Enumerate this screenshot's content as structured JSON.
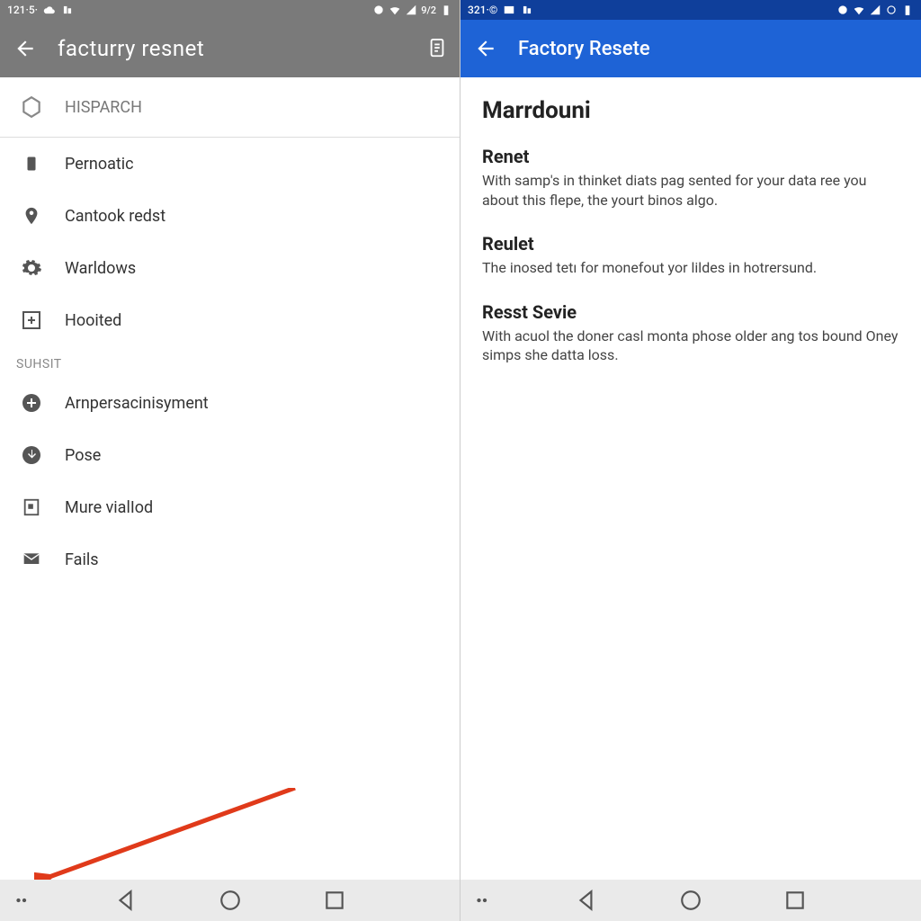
{
  "left": {
    "status": {
      "time": "121·5·",
      "indicators": "9/2"
    },
    "appbar": {
      "title": "facturry resnet"
    },
    "section1": {
      "header": "HISPARCH"
    },
    "items1": [
      {
        "icon": "phone-icon",
        "label": "Pernoatic"
      },
      {
        "icon": "pin-icon",
        "label": "Cantook redst"
      },
      {
        "icon": "gear-icon",
        "label": "Warldows"
      },
      {
        "icon": "plus-box-icon",
        "label": "Hooited"
      }
    ],
    "group2_label": "SUHSIT",
    "items2": [
      {
        "icon": "plus-circle-icon",
        "label": "Arnpersacinisyment"
      },
      {
        "icon": "download-icon",
        "label": "Pose"
      },
      {
        "icon": "note-icon",
        "label": "Mure vialIod"
      },
      {
        "icon": "mail-icon",
        "label": "Fails"
      }
    ]
  },
  "right": {
    "status": {
      "time": "321·©"
    },
    "appbar": {
      "title": "Factory Resete"
    },
    "heading": "Marrdouni",
    "blocks": [
      {
        "title": "Renet",
        "body": "With samp's in thinket diats pag sented for your data ree you about this flepe, the yourt binos algo."
      },
      {
        "title": "Reulet",
        "body": "The inosed tetı for monefout yor lildes in hotrersund."
      },
      {
        "title": "Resst Sevie",
        "body": "With acuol the doner casl monta phose older ang tos bound Oney simps she datta loss."
      }
    ]
  }
}
